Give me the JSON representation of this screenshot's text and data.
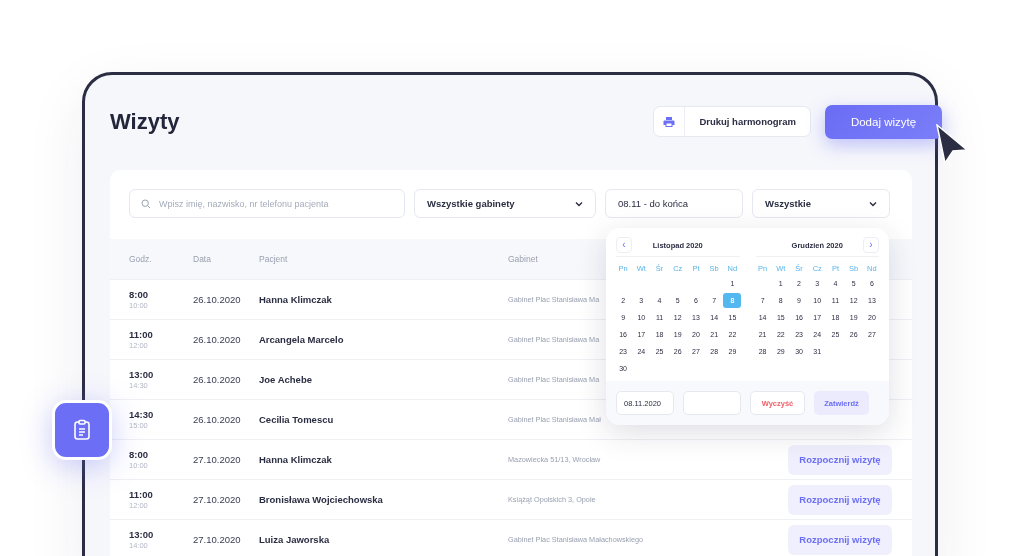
{
  "title": "Wizyty",
  "print_button": {
    "label": "Drukuj harmonogram"
  },
  "add_button": {
    "label": "Dodaj wizytę"
  },
  "filters": {
    "search": {
      "placeholder": "Wpisz imię, nazwisko, nr telefonu pacjenta"
    },
    "office": {
      "value": "Wszystkie gabinety"
    },
    "date_range": {
      "value": "08.11 - do końca"
    },
    "status": {
      "value": "Wszystkie"
    }
  },
  "table": {
    "columns": [
      "Godz.",
      "Data",
      "Pacjent",
      "Gabinet"
    ],
    "rows": [
      {
        "start": "8:00",
        "end": "10:00",
        "date": "26.10.2020",
        "patient": "Hanna Klimczak",
        "office": "Gabinet Plac Stanisława Ma"
      },
      {
        "start": "11:00",
        "end": "12:00",
        "date": "26.10.2020",
        "patient": "Arcangela Marcelo",
        "office": "Gabinet Plac Stanisława Ma"
      },
      {
        "start": "13:00",
        "end": "14:30",
        "date": "26.10.2020",
        "patient": "Joe Achebe",
        "office": "Gabinet Plac Stanisława Ma"
      },
      {
        "start": "14:30",
        "end": "15:00",
        "date": "26.10.2020",
        "patient": "Cecilia Tomescu",
        "office": "Gabinet Plac Stanisława Mał"
      },
      {
        "start": "8:00",
        "end": "10:00",
        "date": "27.10.2020",
        "patient": "Hanna Klimczak",
        "office": "Mazowiecka 51/13, Wrocław",
        "action": "Rozpocznij wizytę"
      },
      {
        "start": "11:00",
        "end": "12:00",
        "date": "27.10.2020",
        "patient": "Bronisława Wojciechowska",
        "office": "Książąt Opolskich 3, Opole",
        "action": "Rozpocznij wizytę"
      },
      {
        "start": "13:00",
        "end": "14:00",
        "date": "27.10.2020",
        "patient": "Luiza Jaworska",
        "office": "Gabinet Plac Stanisława Małachowskiego",
        "action": "Rozpocznij wizytę"
      }
    ]
  },
  "calendar": {
    "prev": "‹",
    "next": "›",
    "months": [
      {
        "title": "Listopad 2020",
        "weekdays": [
          "Pn",
          "Wt",
          "Śr",
          "Cz",
          "Pt",
          "Sb",
          "Nd"
        ],
        "weeks": [
          [
            {
              "kind": "blank"
            },
            {
              "kind": "blank"
            },
            {
              "kind": "blank"
            },
            {
              "kind": "blank"
            },
            {
              "kind": "blank"
            },
            {
              "kind": "blank"
            },
            {
              "kind": "day",
              "day": "1",
              "selected": false
            }
          ],
          [
            {
              "kind": "day",
              "day": "2",
              "selected": false
            },
            {
              "kind": "day",
              "day": "3",
              "selected": false
            },
            {
              "kind": "day",
              "day": "4",
              "selected": false
            },
            {
              "kind": "day",
              "day": "5",
              "selected": false
            },
            {
              "kind": "day",
              "day": "6",
              "selected": false
            },
            {
              "kind": "day",
              "day": "7",
              "selected": false
            },
            {
              "kind": "day",
              "day": "8",
              "selected": true
            }
          ],
          [
            {
              "kind": "day",
              "day": "9",
              "selected": false
            },
            {
              "kind": "day",
              "day": "10",
              "selected": false
            },
            {
              "kind": "day",
              "day": "11",
              "selected": false
            },
            {
              "kind": "day",
              "day": "12",
              "selected": false
            },
            {
              "kind": "day",
              "day": "13",
              "selected": false
            },
            {
              "kind": "day",
              "day": "14",
              "selected": false
            },
            {
              "kind": "day",
              "day": "15",
              "selected": false
            }
          ],
          [
            {
              "kind": "day",
              "day": "16",
              "selected": false
            },
            {
              "kind": "day",
              "day": "17",
              "selected": false
            },
            {
              "kind": "day",
              "day": "18",
              "selected": false
            },
            {
              "kind": "day",
              "day": "19",
              "selected": false
            },
            {
              "kind": "day",
              "day": "20",
              "selected": false
            },
            {
              "kind": "day",
              "day": "21",
              "selected": false
            },
            {
              "kind": "day",
              "day": "22",
              "selected": false
            }
          ],
          [
            {
              "kind": "day",
              "day": "23",
              "selected": false
            },
            {
              "kind": "day",
              "day": "24",
              "selected": false
            },
            {
              "kind": "day",
              "day": "25",
              "selected": false
            },
            {
              "kind": "day",
              "day": "26",
              "selected": false
            },
            {
              "kind": "day",
              "day": "27",
              "selected": false
            },
            {
              "kind": "day",
              "day": "28",
              "selected": false
            },
            {
              "kind": "day",
              "day": "29",
              "selected": false
            }
          ],
          [
            {
              "kind": "day",
              "day": "30",
              "selected": false
            }
          ]
        ]
      },
      {
        "title": "Grudzień 2020",
        "weekdays": [
          "Pn",
          "Wt",
          "Śr",
          "Cz",
          "Pt",
          "Sb",
          "Nd"
        ],
        "weeks": [
          [
            {
              "kind": "blank"
            },
            {
              "kind": "day",
              "day": "1",
              "selected": false
            },
            {
              "kind": "day",
              "day": "2",
              "selected": false
            },
            {
              "kind": "day",
              "day": "3",
              "selected": false
            },
            {
              "kind": "day",
              "day": "4",
              "selected": false
            },
            {
              "kind": "day",
              "day": "5",
              "selected": false
            },
            {
              "kind": "day",
              "day": "6",
              "selected": false
            }
          ],
          [
            {
              "kind": "day",
              "day": "7",
              "selected": false
            },
            {
              "kind": "day",
              "day": "8",
              "selected": false
            },
            {
              "kind": "day",
              "day": "9",
              "selected": false
            },
            {
              "kind": "day",
              "day": "10",
              "selected": false
            },
            {
              "kind": "day",
              "day": "11",
              "selected": false
            },
            {
              "kind": "day",
              "day": "12",
              "selected": false
            },
            {
              "kind": "day",
              "day": "13",
              "selected": false
            }
          ],
          [
            {
              "kind": "day",
              "day": "14",
              "selected": false
            },
            {
              "kind": "day",
              "day": "15",
              "selected": false
            },
            {
              "kind": "day",
              "day": "16",
              "selected": false
            },
            {
              "kind": "day",
              "day": "17",
              "selected": false
            },
            {
              "kind": "day",
              "day": "18",
              "selected": false
            },
            {
              "kind": "day",
              "day": "19",
              "selected": false
            },
            {
              "kind": "day",
              "day": "20",
              "selected": false
            }
          ],
          [
            {
              "kind": "day",
              "day": "21",
              "selected": false
            },
            {
              "kind": "day",
              "day": "22",
              "selected": false
            },
            {
              "kind": "day",
              "day": "23",
              "selected": false
            },
            {
              "kind": "day",
              "day": "24",
              "selected": false
            },
            {
              "kind": "day",
              "day": "25",
              "selected": false
            },
            {
              "kind": "day",
              "day": "26",
              "selected": false
            },
            {
              "kind": "day",
              "day": "27",
              "selected": false
            }
          ],
          [
            {
              "kind": "day",
              "day": "28",
              "selected": false
            },
            {
              "kind": "day",
              "day": "29",
              "selected": false
            },
            {
              "kind": "day",
              "day": "30",
              "selected": false
            },
            {
              "kind": "day",
              "day": "31",
              "selected": false
            }
          ]
        ]
      }
    ],
    "start_date": "08.11.2020",
    "clear_button": "Wyczyść",
    "confirm_button": "Zatwierdź"
  }
}
